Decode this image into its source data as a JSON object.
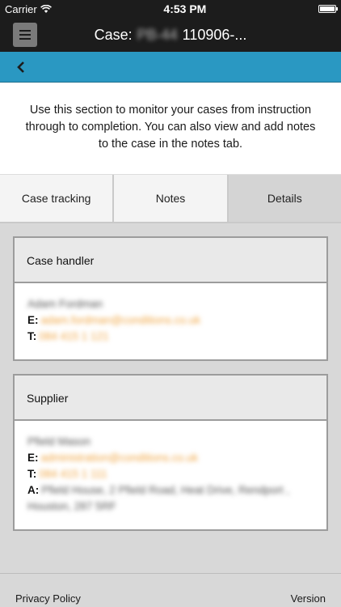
{
  "status": {
    "carrier": "Carrier",
    "time": "4:53 PM"
  },
  "header": {
    "title_prefix": "Case:",
    "title_hidden": "PB-44",
    "title_suffix": "110906-..."
  },
  "intro": "Use this section to monitor your cases from instruction through to completion. You can also view and add notes to the case in the notes tab.",
  "tabs": [
    {
      "label": "Case tracking"
    },
    {
      "label": "Notes"
    },
    {
      "label": "Details"
    }
  ],
  "cards": {
    "handler": {
      "title": "Case handler",
      "name": "Adam Fordman",
      "email_label": "E:",
      "email": "adam.fordman@conditions.co.uk",
      "phone_label": "T:",
      "phone": "084 415 1 121"
    },
    "supplier": {
      "title": "Supplier",
      "name": "Pfield Mason",
      "email_label": "E:",
      "email": "administration@conditions.co.uk",
      "phone_label": "T:",
      "phone": "084 415 1 111",
      "address_label": "A:",
      "address_line1": "Pfield House, 2 Pfield Road, Heat Drive, Rendport ,",
      "address_line2": "Houston, 287 5RF"
    }
  },
  "footer": {
    "privacy": "Privacy Policy",
    "version": "Version"
  }
}
